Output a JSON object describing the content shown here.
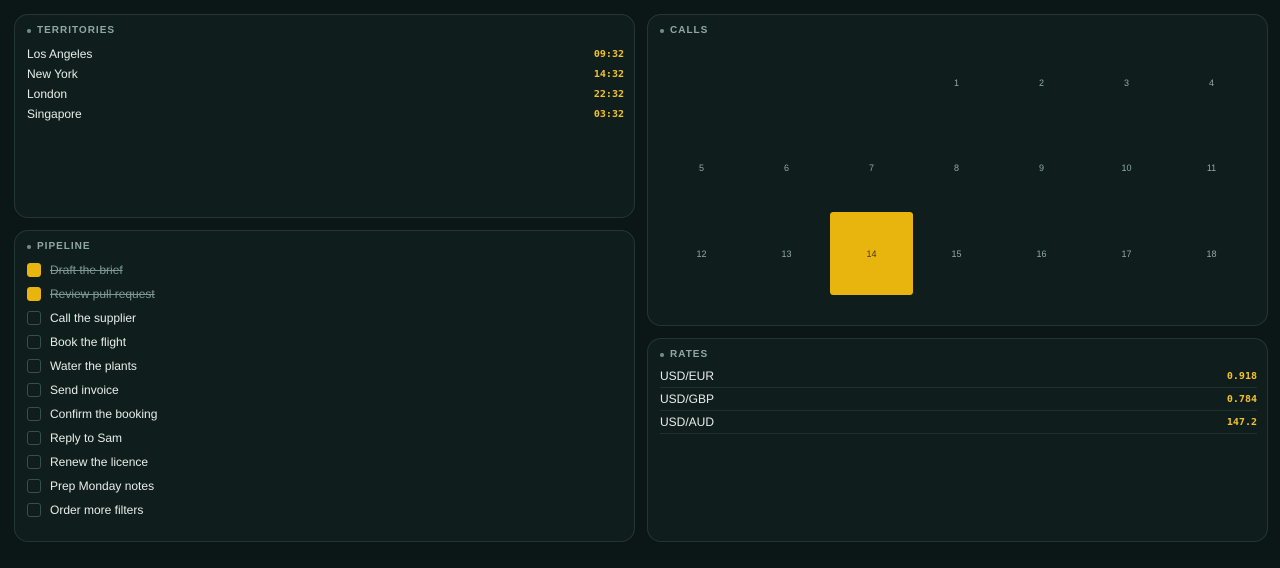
{
  "territories": {
    "title": "TERRITORIES",
    "items": [
      {
        "city": "Los Angeles",
        "time": "09:32"
      },
      {
        "city": "New York",
        "time": "14:32"
      },
      {
        "city": "London",
        "time": "22:32"
      },
      {
        "city": "Singapore",
        "time": "03:32"
      }
    ]
  },
  "pipeline": {
    "title": "PIPELINE",
    "items": [
      {
        "label": "Draft the brief",
        "done": true
      },
      {
        "label": "Review pull request",
        "done": true
      },
      {
        "label": "Call the supplier",
        "done": false
      },
      {
        "label": "Book the flight",
        "done": false
      },
      {
        "label": "Water the plants",
        "done": false
      },
      {
        "label": "Send invoice",
        "done": false
      },
      {
        "label": "Confirm the booking",
        "done": false
      },
      {
        "label": "Reply to Sam",
        "done": false
      },
      {
        "label": "Renew the licence",
        "done": false
      },
      {
        "label": "Prep Monday notes",
        "done": false
      },
      {
        "label": "Order more filters",
        "done": false
      }
    ]
  },
  "calls": {
    "title": "CALLS",
    "leading_blank_days": 3,
    "days": [
      "1",
      "2",
      "3",
      "4",
      "5",
      "6",
      "7",
      "8",
      "9",
      "10",
      "11",
      "12",
      "13",
      "14",
      "15",
      "16",
      "17",
      "18"
    ],
    "highlighted_day": "14"
  },
  "rates": {
    "title": "RATES",
    "items": [
      {
        "pair": "USD/EUR",
        "value": "0.918"
      },
      {
        "pair": "USD/GBP",
        "value": "0.784"
      },
      {
        "pair": "USD/AUD",
        "value": "147.2"
      }
    ]
  },
  "colors": {
    "accent": "#e8b40e",
    "background": "#0b1716",
    "panel": "#0f1d1c"
  }
}
